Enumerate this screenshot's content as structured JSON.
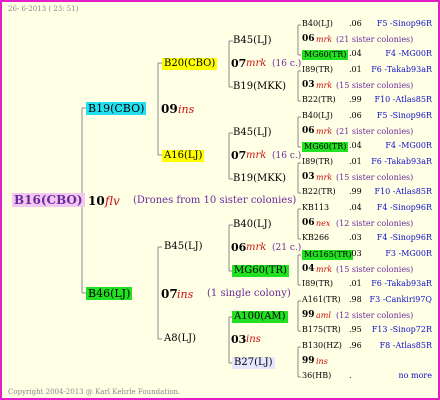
{
  "header": {
    "date": "26-  6-2013 ( 23: 51)"
  },
  "footer": {
    "copyright": "Copyright 2004-2013 @ Karl Kehrle Foundation."
  },
  "colors": {
    "frame": "#e020c8",
    "background": "#ffffe6",
    "line": "#888888"
  },
  "root": {
    "id": "B16(CBO)",
    "year": "10",
    "mark": "flv",
    "note": "(Drones from 10 sister colonies)"
  },
  "gen1": [
    {
      "id": "B19(CBO)",
      "year": "09",
      "mark": "ins"
    },
    {
      "id": "B46(LJ)",
      "year": "07",
      "mark": "ins",
      "note": "(1 single colony)"
    }
  ],
  "gen2": [
    {
      "id": "B20(CBO)",
      "year": "07",
      "mark": "mrk",
      "note": "(16 c.)"
    },
    {
      "id": "A16(LJ)",
      "year": "07",
      "mark": "mrk",
      "note": "(16 c.)"
    },
    {
      "id": "B45(LJ)",
      "year": "06",
      "mark": "mrk",
      "note": "(21 c.)"
    },
    {
      "id": "A8(LJ)",
      "year": "03",
      "mark": "ins"
    }
  ],
  "gen3": [
    {
      "left": "B45(LJ)",
      "year": "07",
      "mark": "mrk",
      "note": "(16 c.)",
      "right": "B19(MKK)"
    },
    {
      "left": "B45(LJ)",
      "year": "07",
      "mark": "mrk",
      "note": "(16 c.)",
      "right": "B19(MKK)"
    },
    {
      "left": "B40(LJ)",
      "year": "06",
      "mark": "mrk",
      "note": "(21 c.)",
      "right": "MG60(TR)"
    },
    {
      "left": "A100(AM)",
      "year": "03",
      "mark": "ins",
      "right": "B27(LJ)"
    }
  ],
  "gen4": [
    {
      "top": {
        "id": "B40(LJ)",
        "val": ".06",
        "src": "F5 -Sinop96R"
      },
      "year": "06",
      "mark": "mrk",
      "note": "(21 sister colonies)",
      "bot": {
        "id": "MG60(TR)",
        "val": ".04",
        "src": "F4 -MG00R"
      }
    },
    {
      "top": {
        "id": "I89(TR)",
        "val": ".01",
        "src": "F6 -Takab93aR"
      },
      "year": "03",
      "mark": "mrk",
      "note": "(15 sister colonies)",
      "bot": {
        "id": "B22(TR)",
        "val": ".99",
        "src": "F10 -Atlas85R"
      }
    },
    {
      "top": {
        "id": "B40(LJ)",
        "val": ".06",
        "src": "F5 -Sinop96R"
      },
      "year": "06",
      "mark": "mrk",
      "note": "(21 sister colonies)",
      "bot": {
        "id": "MG60(TR)",
        "val": ".04",
        "src": "F4 -MG00R"
      }
    },
    {
      "top": {
        "id": "I89(TR)",
        "val": ".01",
        "src": "F6 -Takab93aR"
      },
      "year": "03",
      "mark": "mrk",
      "note": "(15 sister colonies)",
      "bot": {
        "id": "B22(TR)",
        "val": ".99",
        "src": "F10 -Atlas85R"
      }
    },
    {
      "top": {
        "id": "KB113",
        "val": ".04",
        "src": "F4 -Sinop96R"
      },
      "year": "06",
      "mark": "nex",
      "note": "(12 sister colonies)",
      "bot": {
        "id": "KB266",
        "val": ".03",
        "src": "F4 -Sinop96R"
      }
    },
    {
      "top": {
        "id": "MG165(TR)",
        "val": ".03",
        "src": "F3 -MG00R"
      },
      "year": "04",
      "mark": "mrk",
      "note": "(15 sister colonies)",
      "bot": {
        "id": "I89(TR)",
        "val": ".01",
        "src": "F6 -Takab93aR"
      }
    },
    {
      "top": {
        "id": "A161(TR)",
        "val": ".98",
        "src": "F3 -Cankiri97Q"
      },
      "year": "99",
      "mark": "aml",
      "note": "(12 sister colonies)",
      "bot": {
        "id": "B175(TR)",
        "val": ".95",
        "src": "F13 -Sinop72R"
      }
    },
    {
      "top": {
        "id": "B130(HZ)",
        "val": ".96",
        "src": "F8 -Atlas85R"
      },
      "year": "99",
      "mark": "ins",
      "note": "",
      "bot": {
        "id": "36(HB)",
        "val": ".",
        "src": "no more"
      }
    }
  ]
}
